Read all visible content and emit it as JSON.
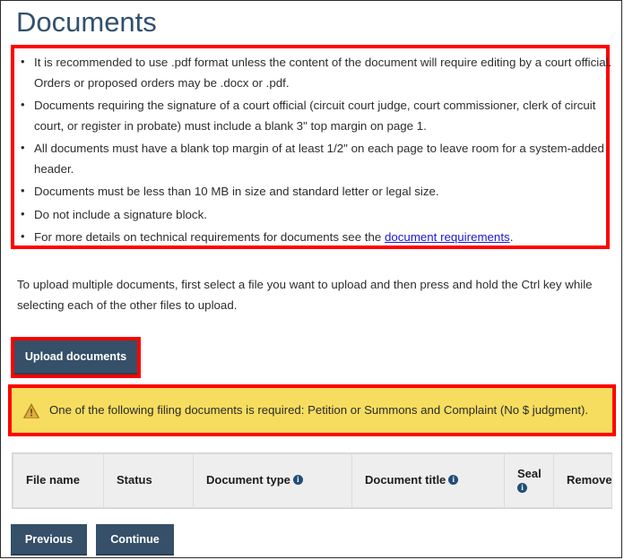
{
  "page": {
    "title": "Documents"
  },
  "guidelines": {
    "items": [
      {
        "text": "It is recommended to use .pdf format unless the content of the document will require editing by a court official. Orders or proposed orders may be .docx or .pdf."
      },
      {
        "text": "Documents requiring the signature of a court official (circuit court judge, court commissioner, clerk of circuit court, or register in probate) must include a blank 3\" top margin on page 1."
      },
      {
        "text": "All documents must have a blank top margin of at least 1/2\" on each page to leave room for a system-added header."
      },
      {
        "text": "Documents must be less than 10 MB in size and standard letter or legal size."
      },
      {
        "text": "Do not include a signature block."
      },
      {
        "prefix": "For more details on technical requirements for documents see the ",
        "link": "document requirements",
        "suffix": "."
      }
    ]
  },
  "instructions": {
    "paragraph": "To upload multiple documents, first select a file you want to upload and then press and hold the Ctrl key while selecting each of the other files to upload."
  },
  "upload": {
    "button_label": "Upload documents"
  },
  "warning": {
    "icon": "warning-triangle-icon",
    "message": "One of the following filing documents is required: Petition or Summons and Complaint (No $ judgment).",
    "background_color": "#f7dd5f",
    "border_color": "#fe0000"
  },
  "table": {
    "columns": [
      {
        "label": "File name",
        "info": false
      },
      {
        "label": "Status",
        "info": false
      },
      {
        "label": "Document type",
        "info": true
      },
      {
        "label": "Document title",
        "info": true
      },
      {
        "label": "Seal",
        "info": true
      },
      {
        "label": "Remove",
        "info": false
      }
    ],
    "rows": []
  },
  "footer": {
    "previous_label": "Previous",
    "continue_label": "Continue"
  },
  "colors": {
    "title": "#31506e",
    "button": "#355068",
    "link": "#1a18d6",
    "highlight": "#fe0000"
  }
}
